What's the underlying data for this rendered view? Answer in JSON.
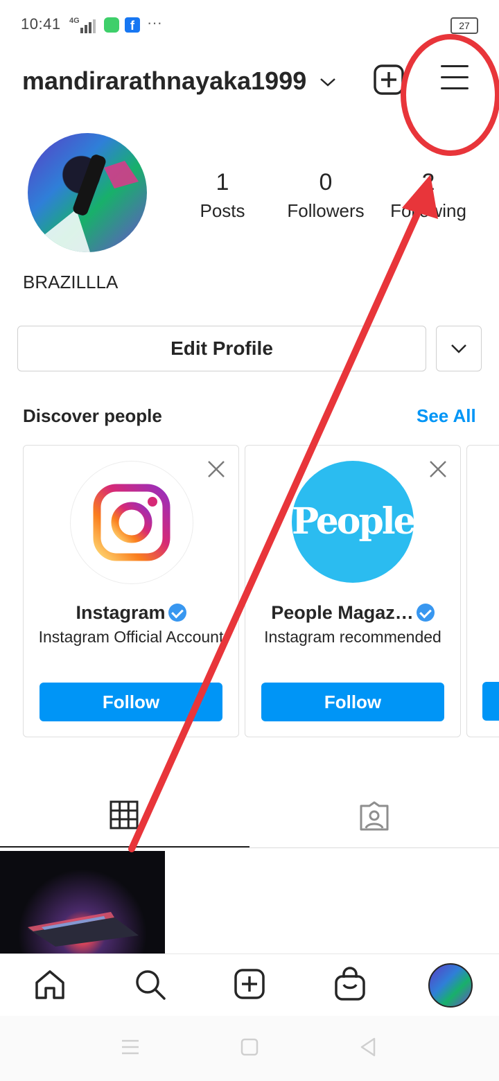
{
  "status_bar": {
    "time": "10:41",
    "network": "4G",
    "battery": "27",
    "more": "···"
  },
  "header": {
    "username": "mandirarathnayaka1999"
  },
  "profile": {
    "display_name": "BRAZILLLA",
    "stats": [
      {
        "value": "1",
        "label": "Posts"
      },
      {
        "value": "0",
        "label": "Followers"
      },
      {
        "value": "2",
        "label": "Following"
      }
    ],
    "edit_profile_label": "Edit Profile"
  },
  "discover": {
    "title": "Discover people",
    "see_all": "See All",
    "cards": [
      {
        "name": "Instagram",
        "subtitle": "Instagram Official Account",
        "follow_label": "Follow"
      },
      {
        "name": "People Magaz…",
        "subtitle": "Instagram recommended",
        "follow_label": "Follow",
        "logo_text": "People"
      }
    ]
  },
  "colors": {
    "accent": "#0095f6",
    "annotation": "#e8353a",
    "text": "#262626"
  },
  "icons": [
    "chevron-down-icon",
    "plus-square-icon",
    "menu-icon",
    "close-icon",
    "grid-icon",
    "tagged-icon",
    "home-icon",
    "search-icon",
    "add-post-icon",
    "shop-icon"
  ]
}
